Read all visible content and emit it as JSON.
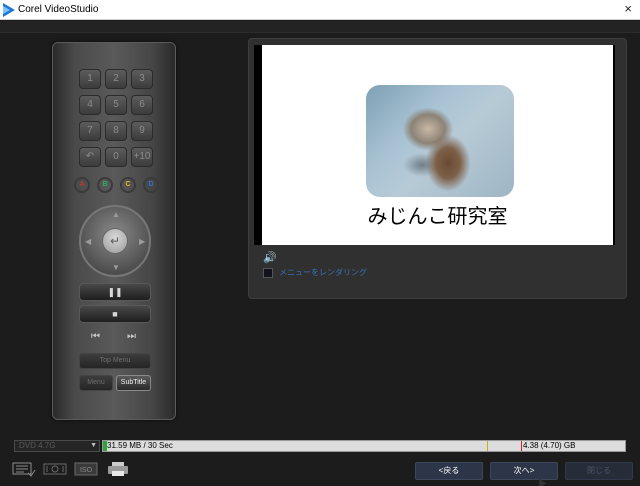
{
  "window": {
    "title": "Corel VideoStudio",
    "close_icon": "×"
  },
  "remote": {
    "keys": [
      "1",
      "2",
      "3",
      "4",
      "5",
      "6",
      "7",
      "8",
      "9",
      "↶",
      "0",
      "+10"
    ],
    "color_buttons": [
      {
        "label": "A",
        "color": "#c0392b"
      },
      {
        "label": "B",
        "color": "#27ae60"
      },
      {
        "label": "C",
        "color": "#d4c020"
      },
      {
        "label": "D",
        "color": "#2e6fd0"
      }
    ],
    "enter_icon": "↵",
    "play_pause": "❚❚",
    "stop": "■",
    "prev": "⏮",
    "next": "⏭",
    "top_menu": "Top Menu",
    "menu": "Menu",
    "subtitle": "SubTitle"
  },
  "preview": {
    "caption": "みじんこ研究室",
    "speaker_icon": "🔊",
    "menu_rendering_label": "メニューをレンダリング"
  },
  "disc": {
    "selected": "DVD 4.7G",
    "used_text": "31.59 MB / 30 Sec",
    "capacity_text": "4.38 (4.70) GB",
    "used_fraction": 0.007
  },
  "toolbar": {
    "back": "<戻る",
    "next": "次へ>",
    "cancel": "閉じる"
  }
}
